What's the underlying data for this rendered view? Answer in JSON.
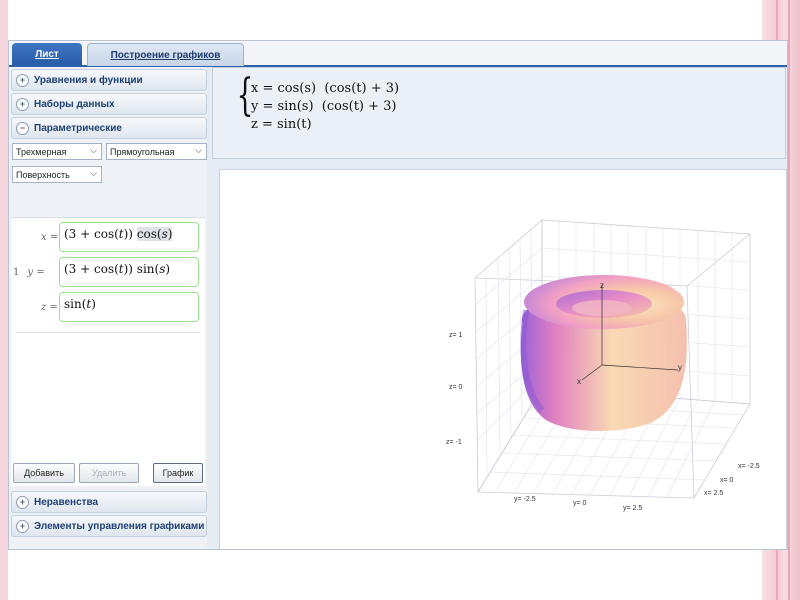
{
  "tabs": [
    {
      "label": "Лист",
      "active": true
    },
    {
      "label": "Построение графиков",
      "active": false
    }
  ],
  "sidebar": {
    "sections_top": [
      {
        "label": "Уравнения и функции"
      },
      {
        "label": "Наборы данных"
      },
      {
        "label": "Параметрические"
      }
    ],
    "dropdowns": {
      "dimension": "Трехмерная",
      "coordinates": "Прямоугольная",
      "surface_type": "Поверхность"
    },
    "equations": {
      "x_label": "x",
      "y_number": "1",
      "y_label": "y",
      "z_label": "z",
      "equals": "="
    },
    "buttons": {
      "add": "Добавить",
      "delete": "Удалить",
      "graph": "График"
    },
    "sections_bottom": [
      {
        "label": "Неравенства"
      },
      {
        "label": "Элементы управления графиками"
      }
    ]
  },
  "formula": {
    "line1": "x = cos(s)  (cos(t) + 3)",
    "line2": "y = sin(s)  (cos(t) + 3)",
    "line3": "z = sin(t)"
  },
  "plot": {
    "axis_labels": {
      "z": "z",
      "y": "y",
      "x": "x"
    },
    "z_ticks": [
      "z= 1",
      "z= 0",
      "z= -1"
    ],
    "y_ticks": [
      "y= -2.5",
      "y= 0",
      "y= 2.5"
    ],
    "x_ticks": [
      "x= -2.5",
      "x= 0",
      "x= 2.5"
    ]
  },
  "colors": {
    "tab_active": "#285ca8",
    "section_text": "#1e3f73",
    "equation_border": "#9be08f",
    "surface_pink": "#f2a0c4",
    "surface_peach": "#f9dfb8",
    "surface_violet": "#8f5fd6",
    "slide_pink": "#f3c9d1"
  }
}
